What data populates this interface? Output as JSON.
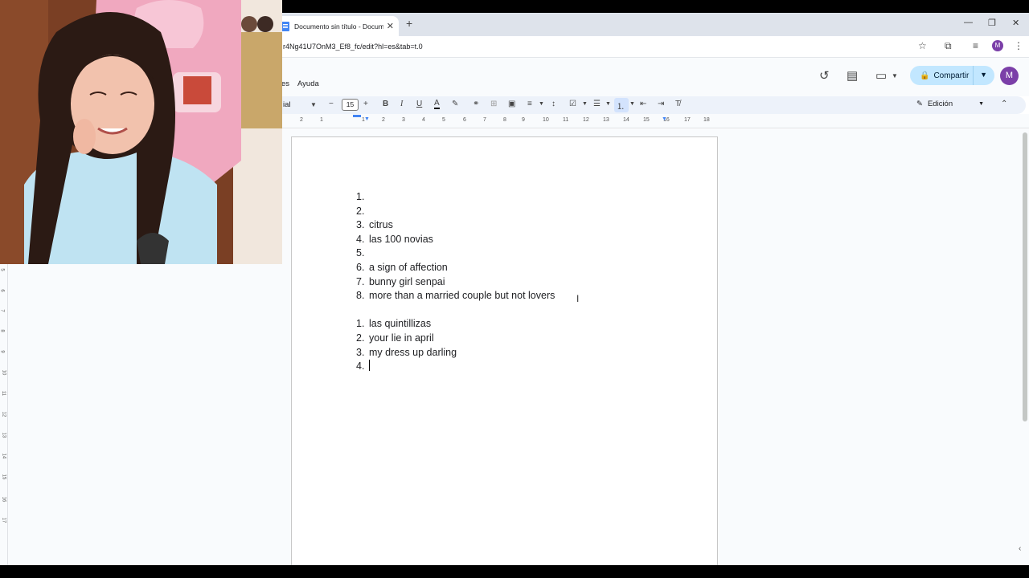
{
  "browser": {
    "tab_title": "Documento sin título - Documentos de Google",
    "url": "r4Ng41U7OnM3_Ef8_fc/edit?hl=es&tab=t.0",
    "profile_initial": "M"
  },
  "docs": {
    "menu": {
      "partial_item": "es",
      "help": "Ayuda"
    },
    "share_label": "Compartir",
    "profile_initial": "M",
    "toolbar": {
      "font_name": "ial",
      "font_size": "15",
      "mode_label": "Edición"
    },
    "ruler_numbers": [
      "2",
      "1",
      "1",
      "2",
      "3",
      "4",
      "5",
      "6",
      "7",
      "8",
      "9",
      "10",
      "11",
      "12",
      "13",
      "14",
      "15",
      "16",
      "17",
      "18"
    ],
    "vruler_numbers": [
      "5",
      "6",
      "7",
      "8",
      "9",
      "10",
      "11",
      "12",
      "13",
      "14",
      "15",
      "16",
      "17"
    ]
  },
  "document": {
    "list1": [
      {
        "num": "1.",
        "text": ""
      },
      {
        "num": "2.",
        "text": ""
      },
      {
        "num": "3.",
        "text": "citrus"
      },
      {
        "num": "4.",
        "text": "las 100 novias"
      },
      {
        "num": "5.",
        "text": ""
      },
      {
        "num": "6.",
        "text": "a sign of affection"
      },
      {
        "num": "7.",
        "text": "bunny girl senpai"
      },
      {
        "num": "8.",
        "text": "more than a married couple but not lovers"
      }
    ],
    "list2": [
      {
        "num": "1.",
        "text": "las quintillizas"
      },
      {
        "num": "2.",
        "text": "your lie in april"
      },
      {
        "num": "3.",
        "text": "my dress up darling"
      },
      {
        "num": "4.",
        "text": ""
      }
    ]
  },
  "colors": {
    "share_bg": "#c2e7ff",
    "toolbar_bg": "#edf2fa",
    "profile": "#7b3fa8"
  }
}
